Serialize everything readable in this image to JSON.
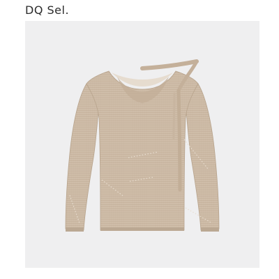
{
  "brand": {
    "name": "DQ Sel."
  },
  "product_photo": {
    "subject_icon": "sweater-icon",
    "background_color": "#efeff0",
    "garment_color": "#cbb8a3"
  }
}
